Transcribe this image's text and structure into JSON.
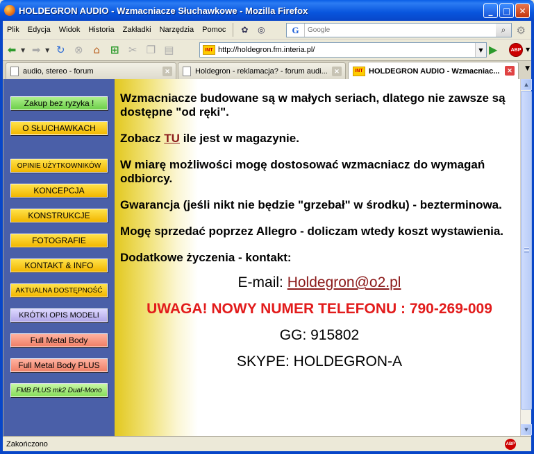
{
  "window": {
    "title": "HOLDEGRON AUDIO - Wzmacniacze Słuchawkowe - Mozilla Firefox",
    "min": "_",
    "max": "□",
    "close": "✕"
  },
  "menu": {
    "items": [
      "Plik",
      "Edycja",
      "Widok",
      "Historia",
      "Zakładki",
      "Narzędzia",
      "Pomoc"
    ]
  },
  "search": {
    "engine_glyph": "G",
    "placeholder": "Google"
  },
  "navbar": {
    "url": "http://holdegron.fm.interia.pl/",
    "site_badge": "INT",
    "abp": "ABP"
  },
  "tabs": [
    {
      "label": "audio, stereo - forum"
    },
    {
      "label": "Holdegron - reklamacja? - forum audi..."
    },
    {
      "label": "HOLDEGRON AUDIO - Wzmacniac..."
    }
  ],
  "sidebar": {
    "buttons": [
      "Zakup bez ryzyka !",
      "O SŁUCHAWKACH",
      "OPINIE UŻYTKOWNIKÓW",
      "KONCEPCJA",
      "KONSTRUKCJE",
      "FOTOGRAFIE",
      "KONTAKT & INFO",
      "AKTUALNA DOSTĘPNOŚĆ",
      "KRÓTKI OPIS MODELI",
      "Full Metal Body",
      "Full Metal Body PLUS",
      "FMB PLUS mk2 Dual-Mono"
    ]
  },
  "content": {
    "p1": "Wzmacniacze budowane są w małych seriach, dlatego nie zawsze są dostępne \"od ręki\".",
    "p2_before": "Zobacz ",
    "p2_link": "TU",
    "p2_after": " ile jest w magazynie.",
    "p3": "W miarę możliwości mogę dostosować wzmacniacz do wymagań odbiorcy.",
    "p4": "Gwarancja (jeśli nikt nie będzie \"grzebał\" w środku) - bezterminowa.",
    "p5": "Mogę sprzedać poprzez Allegro - doliczam wtedy koszt wystawienia.",
    "p6": "Dodatkowe życzenia  - kontakt:",
    "email_label": "E-mail: ",
    "email": "Holdegron@o2.pl",
    "warning": "UWAGA! NOWY NUMER TELEFONU : 790-269-009",
    "gg": "GG: 915802",
    "skype": "SKYPE: HOLDEGRON-A"
  },
  "status": {
    "text": "Zakończono",
    "abp": "ABP"
  }
}
